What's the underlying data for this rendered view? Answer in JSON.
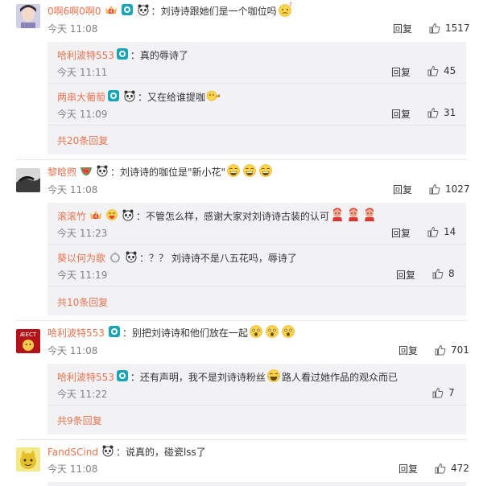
{
  "actions": {
    "reply_label": "回复",
    "colon": "："
  },
  "comments": [
    {
      "user": "0啊6啊0啊0",
      "text": "刘诗诗跟她们是一个咖位吗",
      "time": "今天 11:08",
      "likes": "1517",
      "replies": [
        {
          "user": "哈利波特553",
          "text": "真的辱诗了",
          "time": "今天 11:11",
          "likes": "45"
        },
        {
          "user": "两串大葡萄",
          "text": "又在给谁提咖",
          "time": "今天 11:09",
          "likes": "31"
        }
      ],
      "more": "共20条回复"
    },
    {
      "user": "黎晗煦",
      "text": "刘诗诗的咖位是\"新小花\"",
      "time": "今天 11:08",
      "likes": "1027",
      "replies": [
        {
          "user": "滚滚竹",
          "text": "不管怎么样，感谢大家对刘诗诗古装的认可",
          "time": "今天 11:23",
          "likes": "14"
        },
        {
          "user": "葵以何为歌",
          "text": "？？ 刘诗诗不是八五花吗，辱诗了",
          "time": "今天 11:19",
          "likes": "8"
        }
      ],
      "more": "共10条回复"
    },
    {
      "user": "哈利波特553",
      "text": "别把刘诗诗和他们放在一起",
      "time": "今天 11:08",
      "likes": "701",
      "avatar_text": "ÆECT",
      "replies": [
        {
          "user": "哈利波特553",
          "text": "还有声明，我不是刘诗诗粉丝",
          "text2": "路人看过她作品的观众而已",
          "time": "今天 11:22",
          "likes": "7"
        }
      ],
      "more": "共9条回复"
    },
    {
      "user": "FandSCind",
      "text": "说真的，碰瓷lss了",
      "time": "今天 11:08",
      "likes": "472"
    }
  ],
  "colors": {
    "name": "#eb7350",
    "time": "#808080",
    "sub_bg": "#f2f2f5"
  }
}
